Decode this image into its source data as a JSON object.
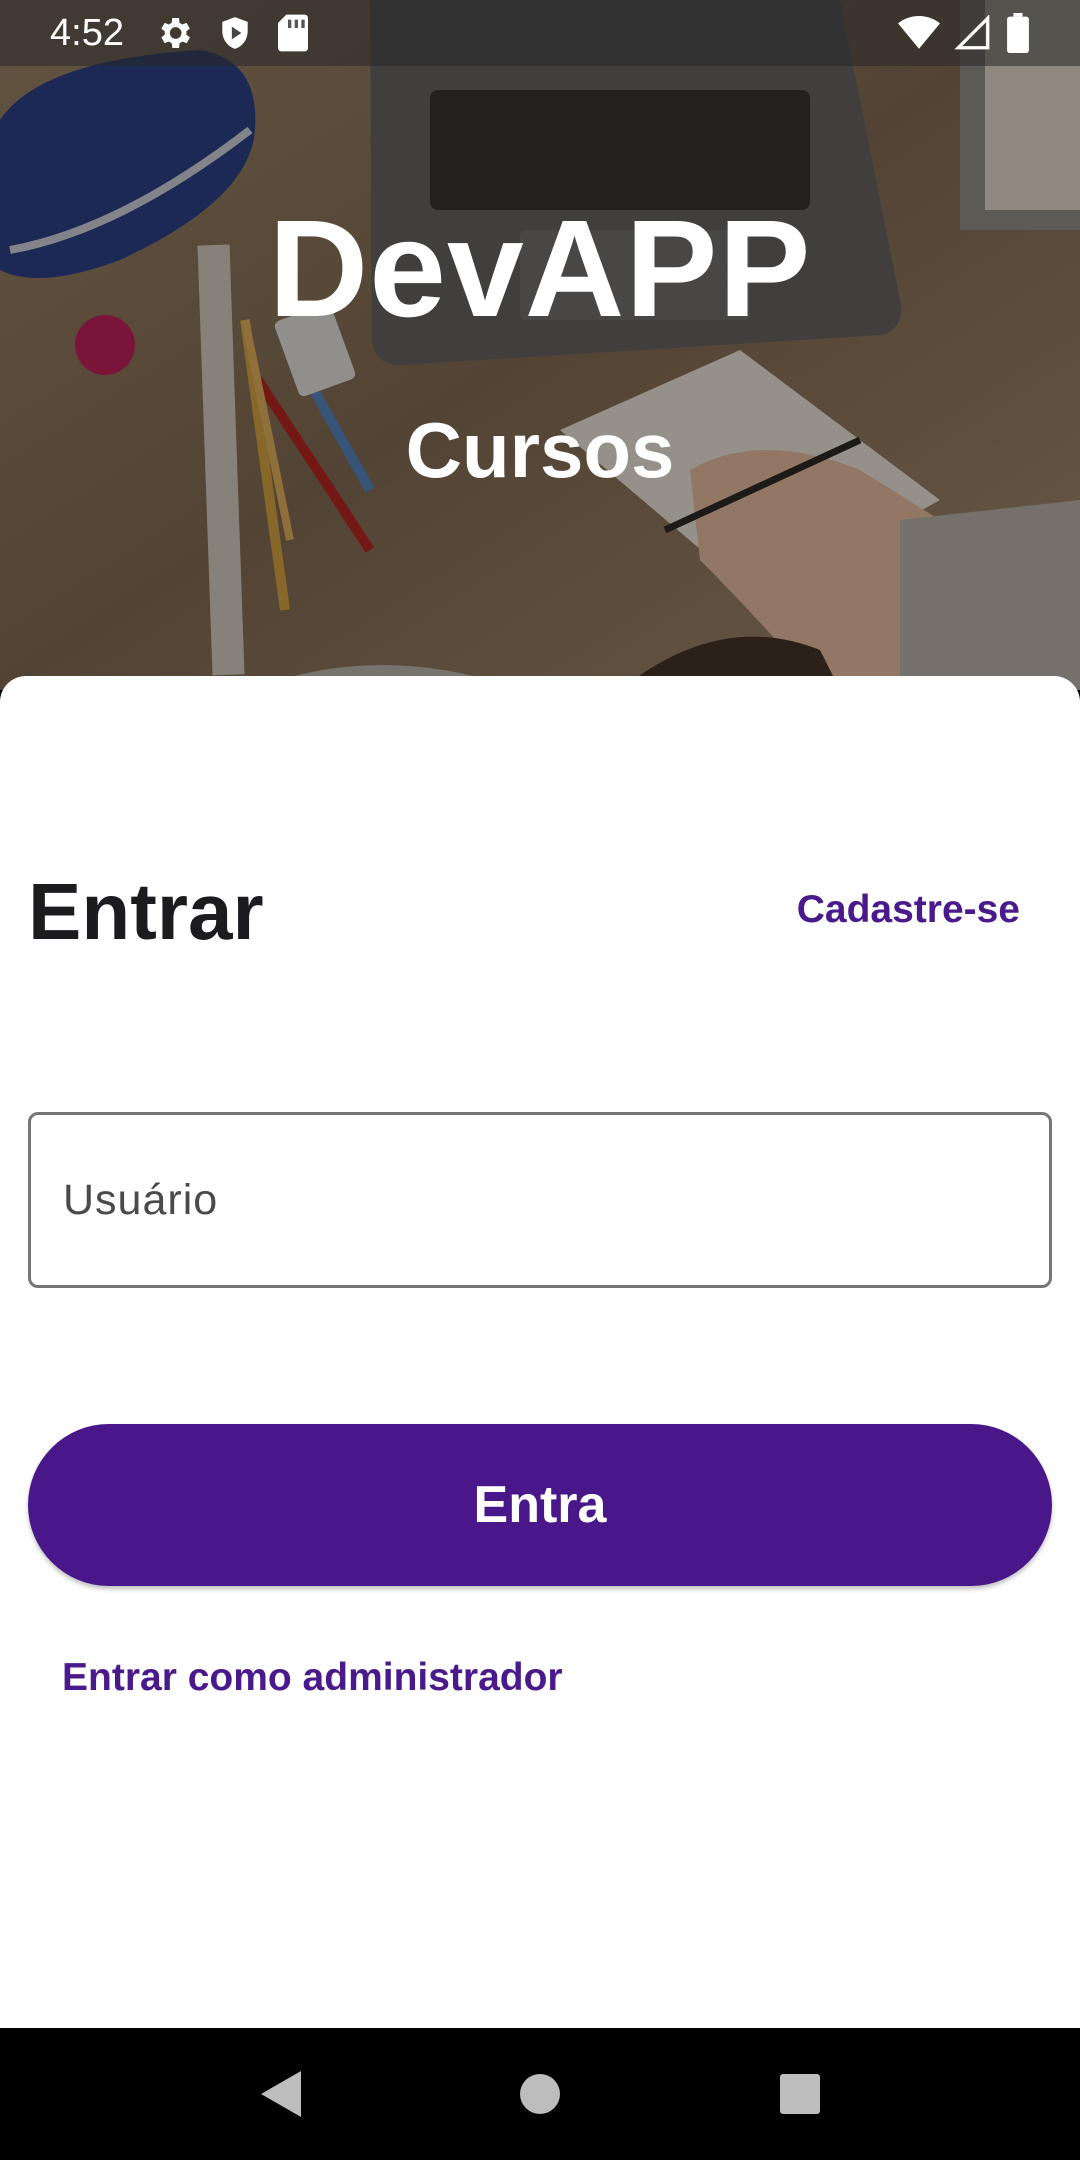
{
  "status_bar": {
    "time": "4:52",
    "left_icons": [
      "gear-icon",
      "shield-play-icon",
      "sd-card-icon"
    ],
    "right_icons": [
      "wifi-icon",
      "signal-icon",
      "battery-icon"
    ]
  },
  "hero": {
    "title": "DevAPP",
    "subtitle": "Cursos"
  },
  "login": {
    "heading": "Entrar",
    "signup_link": "Cadastre-se",
    "username_placeholder": "Usuário",
    "submit_label": "Entra",
    "admin_link": "Entrar como administrador"
  },
  "nav_bar": {
    "buttons": [
      "back-icon",
      "home-icon",
      "recents-icon"
    ]
  },
  "colors": {
    "accent": "#4a178b",
    "link": "#4a1a8c",
    "heading": "#1c1b1f"
  }
}
